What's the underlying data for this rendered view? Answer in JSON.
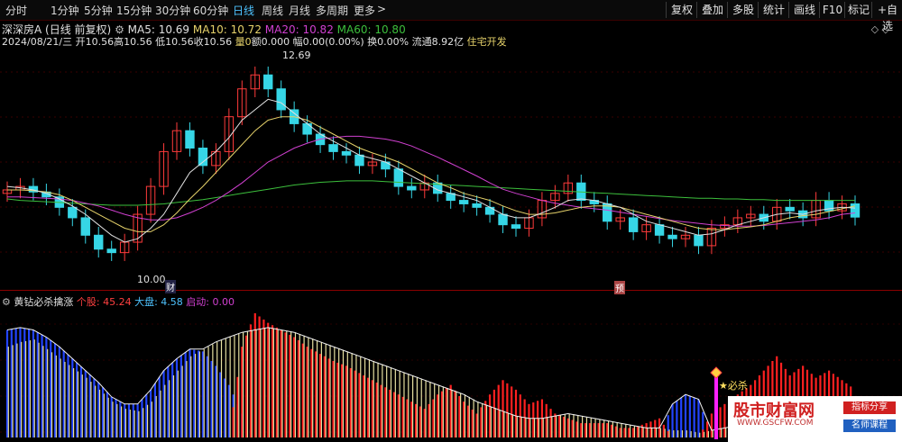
{
  "toolbar": {
    "periods": [
      "分时",
      "1分钟",
      "5分钟",
      "15分钟",
      "30分钟",
      "60分钟",
      "日线",
      "周线",
      "月线",
      "多周期",
      "更多"
    ],
    "active_period": "日线",
    "more_arrow": ">",
    "right_buttons": [
      "复权",
      "叠加",
      "多股",
      "统计",
      "画线",
      "F10",
      "标记",
      "+自选"
    ]
  },
  "stock": {
    "name": "深深房A",
    "mode": "(日线 前复权)",
    "ma5_label": "MA5: 10.69",
    "ma10_label": "MA10: 10.72",
    "ma20_label": "MA20: 10.82",
    "ma60_label": "MA60: 10.80",
    "date": "2024/08/21/三",
    "open": "开10.56",
    "high": "高10.56",
    "low": "低10.56",
    "close": "收10.56",
    "vol": "量0",
    "amount": "额0.000",
    "range": "幅0.00(0.00%)",
    "turnover": "换0.00%",
    "float": "流通8.92亿",
    "sector": "住宅开发",
    "high_marker": "12.69",
    "low_marker": "10.00",
    "tag_cai": "财",
    "tag_yu": "预"
  },
  "indicator": {
    "name": "黄钻必杀擒涨",
    "stock_label": "个股: 45.24",
    "market_label": "大盘: 4.58",
    "start_label": "启动: 0.00",
    "signal_label": "★必杀"
  },
  "watermark": {
    "logo": "股市财富网",
    "url": "WWW.GSCFW.COM",
    "tag1": "指标分享",
    "tag2": "名师课程"
  },
  "colors": {
    "up": "#ff3b3b",
    "down": "#36d6e6",
    "ma5": "#e0e0e0",
    "ma10": "#e6d26a",
    "ma20": "#d040d0",
    "ma60": "#3cbf3c",
    "stock_bar": "#e6e0a0",
    "blue_area": "#2244ff",
    "red_area": "#ff2020"
  },
  "chart_data": {
    "type": "candlestick",
    "ylim": [
      9.8,
      12.9
    ],
    "closes": [
      10.95,
      11.0,
      10.92,
      10.85,
      10.7,
      10.55,
      10.3,
      10.1,
      10.05,
      10.2,
      10.6,
      11.0,
      11.5,
      11.8,
      11.55,
      11.3,
      11.5,
      12.0,
      12.4,
      12.6,
      12.4,
      12.1,
      11.9,
      11.75,
      11.6,
      11.5,
      11.45,
      11.3,
      11.35,
      11.25,
      11.0,
      10.95,
      11.05,
      10.9,
      10.8,
      10.75,
      10.7,
      10.6,
      10.45,
      10.4,
      10.55,
      10.8,
      10.9,
      11.05,
      10.8,
      10.75,
      10.5,
      10.55,
      10.35,
      10.45,
      10.3,
      10.25,
      10.3,
      10.15,
      10.4,
      10.45,
      10.55,
      10.6,
      10.5,
      10.7,
      10.65,
      10.55,
      10.8,
      10.65,
      10.75,
      10.56
    ],
    "ma5": [
      11.0,
      10.98,
      10.95,
      10.9,
      10.82,
      10.72,
      10.6,
      10.45,
      10.3,
      10.2,
      10.25,
      10.4,
      10.6,
      10.9,
      11.2,
      11.35,
      11.5,
      11.7,
      11.95,
      12.1,
      12.25,
      12.2,
      12.05,
      11.9,
      11.75,
      11.65,
      11.55,
      11.45,
      11.4,
      11.35,
      11.25,
      11.15,
      11.05,
      10.95,
      10.9,
      10.85,
      10.8,
      10.7,
      10.6,
      10.55,
      10.55,
      10.62,
      10.7,
      10.8,
      10.82,
      10.8,
      10.75,
      10.7,
      10.6,
      10.5,
      10.45,
      10.4,
      10.35,
      10.3,
      10.32,
      10.38,
      10.45,
      10.5,
      10.55,
      10.6,
      10.62,
      10.6,
      10.65,
      10.68,
      10.7,
      10.69
    ],
    "ma10": [
      10.95,
      10.95,
      10.94,
      10.92,
      10.88,
      10.8,
      10.7,
      10.6,
      10.5,
      10.4,
      10.35,
      10.35,
      10.45,
      10.62,
      10.82,
      11.0,
      11.2,
      11.4,
      11.6,
      11.8,
      11.95,
      12.0,
      12.0,
      11.95,
      11.85,
      11.75,
      11.65,
      11.55,
      11.48,
      11.42,
      11.35,
      11.25,
      11.15,
      11.05,
      10.98,
      10.9,
      10.85,
      10.8,
      10.72,
      10.65,
      10.6,
      10.6,
      10.62,
      10.66,
      10.7,
      10.72,
      10.72,
      10.7,
      10.65,
      10.6,
      10.55,
      10.5,
      10.45,
      10.4,
      10.38,
      10.38,
      10.4,
      10.42,
      10.45,
      10.5,
      10.55,
      10.58,
      10.6,
      10.64,
      10.68,
      10.72
    ],
    "ma20": [
      10.85,
      10.85,
      10.84,
      10.83,
      10.82,
      10.8,
      10.76,
      10.72,
      10.66,
      10.6,
      10.55,
      10.52,
      10.52,
      10.55,
      10.62,
      10.7,
      10.8,
      10.92,
      11.05,
      11.2,
      11.35,
      11.45,
      11.55,
      11.62,
      11.68,
      11.7,
      11.72,
      11.72,
      11.7,
      11.68,
      11.64,
      11.58,
      11.5,
      11.42,
      11.33,
      11.24,
      11.15,
      11.05,
      10.96,
      10.9,
      10.85,
      10.8,
      10.76,
      10.73,
      10.7,
      10.68,
      10.66,
      10.63,
      10.6,
      10.57,
      10.54,
      10.51,
      10.49,
      10.47,
      10.45,
      10.44,
      10.43,
      10.43,
      10.44,
      10.46,
      10.48,
      10.5,
      10.52,
      10.55,
      10.6,
      10.62
    ],
    "ma60": [
      10.82,
      10.8,
      10.79,
      10.78,
      10.77,
      10.76,
      10.75,
      10.74,
      10.73,
      10.73,
      10.73,
      10.74,
      10.75,
      10.77,
      10.79,
      10.81,
      10.84,
      10.87,
      10.9,
      10.93,
      10.96,
      10.99,
      11.02,
      11.04,
      11.06,
      11.07,
      11.08,
      11.08,
      11.08,
      11.07,
      11.06,
      11.05,
      11.04,
      11.03,
      11.02,
      11.01,
      11.0,
      10.99,
      10.98,
      10.97,
      10.96,
      10.95,
      10.94,
      10.93,
      10.92,
      10.91,
      10.9,
      10.89,
      10.88,
      10.87,
      10.86,
      10.85,
      10.84,
      10.83,
      10.83,
      10.82,
      10.82,
      10.81,
      10.81,
      10.8,
      10.8,
      10.8,
      10.8,
      10.8,
      10.8,
      10.8
    ],
    "indicator": {
      "stock_values": [
        38,
        40,
        41,
        37,
        33,
        29,
        25,
        20,
        15,
        12,
        11,
        15,
        22,
        28,
        34,
        37,
        40,
        42,
        44,
        45,
        46,
        45,
        44,
        42,
        40,
        38,
        36,
        34,
        32,
        30,
        28,
        26,
        24,
        22,
        20,
        18,
        15,
        13,
        11,
        9,
        8,
        8,
        9,
        10,
        9,
        8,
        7,
        6,
        5,
        4,
        4,
        3,
        3,
        2,
        3,
        4,
        5,
        6,
        6,
        7,
        8,
        8,
        9,
        10,
        9,
        8
      ],
      "blue_values": [
        45,
        46,
        45,
        42,
        38,
        33,
        28,
        23,
        17,
        14,
        14,
        20,
        28,
        33,
        37,
        36,
        30,
        22,
        10,
        0,
        0,
        0,
        0,
        0,
        0,
        0,
        0,
        0,
        0,
        0,
        0,
        0,
        0,
        0,
        0,
        0,
        0,
        0,
        0,
        0,
        0,
        0,
        0,
        0,
        0,
        0,
        0,
        0,
        0,
        0,
        0,
        14,
        18,
        16,
        0,
        0,
        0,
        0,
        0,
        0,
        0,
        0,
        0,
        0,
        0,
        0
      ],
      "red_values": [
        0,
        0,
        0,
        0,
        0,
        0,
        0,
        0,
        0,
        0,
        0,
        0,
        0,
        0,
        0,
        0,
        0,
        0,
        38,
        52,
        48,
        45,
        42,
        38,
        35,
        32,
        30,
        27,
        24,
        21,
        18,
        15,
        12,
        18,
        22,
        15,
        10,
        18,
        24,
        20,
        14,
        16,
        10,
        8,
        6,
        6,
        6,
        4,
        4,
        6,
        8,
        0,
        0,
        0,
        10,
        14,
        18,
        22,
        28,
        34,
        26,
        30,
        25,
        28,
        24,
        20
      ],
      "ylim": [
        0,
        55
      ]
    }
  }
}
